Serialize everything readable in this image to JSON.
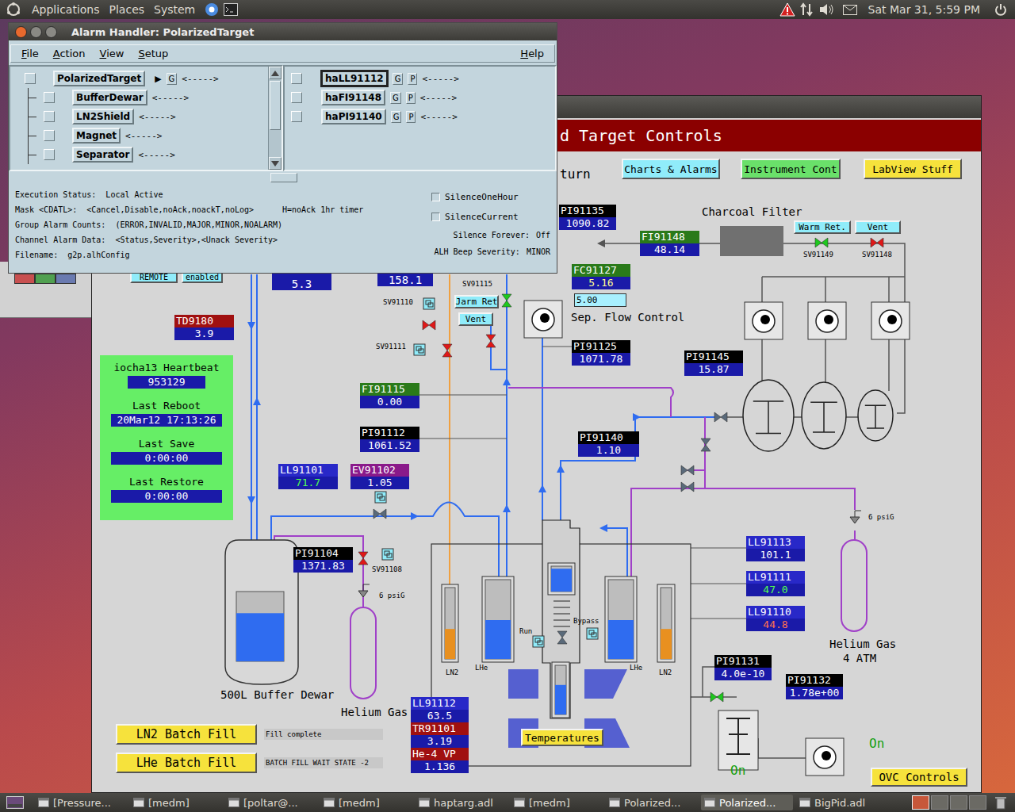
{
  "top_panel": {
    "menus": [
      "Applications",
      "Places",
      "System"
    ],
    "clock": "Sat Mar 31, 5:59 PM"
  },
  "alarm_handler": {
    "title": "Alarm Handler: PolarizedTarget",
    "menus": [
      "File",
      "Action",
      "View",
      "Setup"
    ],
    "help": "Help",
    "root": {
      "name": "PolarizedTarget",
      "arrow": "▶",
      "guidance": "G",
      "status": "<----->"
    },
    "children": [
      {
        "name": "BufferDewar",
        "status": "<----->"
      },
      {
        "name": "LN2Shield",
        "status": "<----->"
      },
      {
        "name": "Magnet",
        "status": "<----->"
      },
      {
        "name": "Separator",
        "status": "<----->"
      }
    ],
    "channels": [
      {
        "name": "haLL91112",
        "guidance": "G",
        "process": "P",
        "status": "<----->",
        "selected": true
      },
      {
        "name": "haFI91148",
        "guidance": "G",
        "process": "P",
        "status": "<----->",
        "selected": false
      },
      {
        "name": "haPI91140",
        "guidance": "G",
        "process": "P",
        "status": "<----->",
        "selected": false
      }
    ],
    "info": [
      [
        "Execution Status:",
        "Local Active"
      ],
      [
        "Mask <CDATL>:",
        "<Cancel,Disable,noAck,noackT,noLog>",
        "H=noAck 1hr timer"
      ],
      [
        "Group Alarm Counts:",
        "(ERROR,INVALID,MAJOR,MINOR,NOALARM)"
      ],
      [
        "Channel Alarm Data:",
        "<Status,Severity>,<Unack Severity>"
      ],
      [
        "Filename:",
        "g2p.alhConfig"
      ]
    ],
    "silence": [
      {
        "label": "SilenceOneHour",
        "checked": false
      },
      {
        "label": "SilenceCurrent",
        "checked": false
      }
    ],
    "settings": [
      [
        "Silence Forever:",
        "Off"
      ],
      [
        "ALH Beep Severity:",
        "MINOR"
      ]
    ]
  },
  "medm": {
    "labels": [
      {
        "text": "d Target Controls",
        "kind": "banner",
        "color": "#8b0000"
      },
      {
        "text": "turn",
        "kind": "plain",
        "color": "#000000"
      },
      {
        "text": "Charts & Alarms",
        "kind": "button",
        "color": "#90ecfa"
      },
      {
        "text": "Instrument Cont",
        "kind": "button",
        "color": "#6ae06a"
      },
      {
        "text": "LabView Stuff",
        "kind": "button",
        "color": "#f6e23c"
      },
      {
        "text": "Charcoal Filter",
        "kind": "plain",
        "color": "#000000"
      },
      {
        "text": "Warm Ret.",
        "kind": "button",
        "color": "#90ecfa"
      },
      {
        "text": "Vent",
        "kind": "button",
        "color": "#90ecfa"
      },
      {
        "text": "SV91149",
        "kind": "small",
        "color": "#000000"
      },
      {
        "text": "SV91148",
        "kind": "small",
        "color": "#000000"
      },
      {
        "text": "SV91115",
        "kind": "small",
        "color": "#000000"
      },
      {
        "text": "Jarm Ret",
        "kind": "button",
        "color": "#90ecfa"
      },
      {
        "text": "Vent",
        "kind": "button",
        "color": "#90ecfa"
      },
      {
        "text": "SV91110",
        "kind": "small",
        "color": "#000000"
      },
      {
        "text": "SV91111",
        "kind": "small",
        "color": "#000000"
      },
      {
        "text": "5.00",
        "kind": "input",
        "color": "#a8f0ff"
      },
      {
        "text": "Sep. Flow Control",
        "kind": "plain",
        "color": "#000000"
      },
      {
        "text": "SV91108",
        "kind": "small",
        "color": "#000000"
      },
      {
        "text": "6 psiG",
        "kind": "small",
        "color": "#000000"
      },
      {
        "text": "6 psiG",
        "kind": "small",
        "color": "#000000"
      },
      {
        "text": "500L Buffer Dewar",
        "kind": "plain",
        "color": "#000000"
      },
      {
        "text": "Helium Gas",
        "kind": "plain",
        "color": "#000000"
      },
      {
        "text": "Helium Gas",
        "kind": "plain",
        "color": "#000000"
      },
      {
        "text": "4 ATM",
        "kind": "plain",
        "color": "#000000"
      },
      {
        "text": "LN2",
        "kind": "small",
        "color": "#000000"
      },
      {
        "text": "LHe",
        "kind": "small",
        "color": "#000000"
      },
      {
        "text": "LHe",
        "kind": "small",
        "color": "#000000"
      },
      {
        "text": "LN2",
        "kind": "small",
        "color": "#000000"
      },
      {
        "text": "Run",
        "kind": "small",
        "color": "#000000"
      },
      {
        "text": "Bypass",
        "kind": "small",
        "color": "#000000"
      },
      {
        "text": "Temperatures",
        "kind": "button",
        "color": "#f6e23c"
      },
      {
        "text": "On",
        "kind": "plain",
        "color": "#10a010"
      },
      {
        "text": "On",
        "kind": "plain",
        "color": "#10a010"
      },
      {
        "text": "OVC Controls",
        "kind": "button",
        "color": "#f6e23c"
      },
      {
        "text": "LN2 Batch Fill",
        "kind": "button",
        "color": "#f6e23c"
      },
      {
        "text": "Fill complete",
        "kind": "display",
        "color": "#c8c8c8"
      },
      {
        "text": "LHe Batch Fill",
        "kind": "button",
        "color": "#f6e23c"
      },
      {
        "text": "BATCH FILL WAIT STATE -2",
        "kind": "display",
        "color": "#c8c8c8"
      },
      {
        "text": "REMOTE",
        "kind": "button",
        "color": "#90ecfa"
      },
      {
        "text": "enabled",
        "kind": "button",
        "color": "#90ecfa"
      },
      {
        "text": "5.3",
        "kind": "value",
        "color": "#1a1aa8"
      },
      {
        "text": "158.1",
        "kind": "value",
        "color": "#1a1aa8"
      }
    ],
    "readouts": [
      {
        "label": "PI91135",
        "value": "1090.82",
        "label_color": "#000000",
        "value_color": "#ffffff"
      },
      {
        "label": "FI91148",
        "value": "48.14",
        "label_color": "#2a7a1a",
        "value_color": "#ffffff"
      },
      {
        "label": "FC91127",
        "value": "5.16",
        "label_color": "#2a7a1a",
        "value_color": "#ffff90"
      },
      {
        "label": "PI91125",
        "value": "1071.78",
        "label_color": "#000000",
        "value_color": "#ffffff"
      },
      {
        "label": "PI91145",
        "value": "15.87",
        "label_color": "#000000",
        "value_color": "#ffffff"
      },
      {
        "label": "FI91115",
        "value": "0.00",
        "label_color": "#2a7a1a",
        "value_color": "#ffffff"
      },
      {
        "label": "PI91112",
        "value": "1061.52",
        "label_color": "#000000",
        "value_color": "#ffffff"
      },
      {
        "label": "PI91140",
        "value": "1.10",
        "label_color": "#000000",
        "value_color": "#ffffff"
      },
      {
        "label": "TD9180",
        "value": "3.9",
        "label_color": "#a01010",
        "value_color": "#ffffff"
      },
      {
        "label": "LL91101",
        "value": "71.7",
        "label_color": "#2828c8",
        "value_color": "#50ff50"
      },
      {
        "label": "EV91102",
        "value": "1.05",
        "label_color": "#8a1a8a",
        "value_color": "#ffffff"
      },
      {
        "label": "PI91104",
        "value": "1371.83",
        "label_color": "#000000",
        "value_color": "#ffffff"
      },
      {
        "label": "LL91113",
        "value": "101.1",
        "label_color": "#2828c8",
        "value_color": "#ffffff"
      },
      {
        "label": "LL91111",
        "value": "47.0",
        "label_color": "#2828c8",
        "value_color": "#50ff50"
      },
      {
        "label": "LL91110",
        "value": "44.8",
        "label_color": "#2828c8",
        "value_color": "#ff7050"
      },
      {
        "label": "PI91131",
        "value": "4.0e-10",
        "label_color": "#000000",
        "value_color": "#ffffff"
      },
      {
        "label": "PI91132",
        "value": "1.78e+00",
        "label_color": "#000000",
        "value_color": "#ffffff"
      },
      {
        "label": "LL91112",
        "value": "63.5",
        "label_color": "#2828c8",
        "value_color": "#ffffff"
      },
      {
        "label": "TR91101",
        "value": "3.19",
        "label_color": "#a01010",
        "value_color": "#ffffff"
      },
      {
        "label": "He-4 VP",
        "value": "1.136",
        "label_color": "#a01010",
        "value_color": "#ffffff"
      }
    ],
    "heartbeat": {
      "title": "iocha13 Heartbeat",
      "count": "953129",
      "items": [
        {
          "label": "Last Reboot",
          "value": "20Mar12 17:13:26"
        },
        {
          "label": "Last Save",
          "value": "0:00:00"
        },
        {
          "label": "Last Restore",
          "value": "0:00:00"
        }
      ]
    },
    "tanks": [
      {
        "level": 0.69,
        "color": "#2f6cf0"
      },
      {
        "level": 0.42,
        "color": "#e89020"
      },
      {
        "level": 0.49,
        "color": "#2f6cf0"
      },
      {
        "level": 0.9,
        "color": "#2f6cf0"
      },
      {
        "level": 0.6,
        "color": "#2f6cf0"
      },
      {
        "level": 0.49,
        "color": "#2f6cf0"
      },
      {
        "level": 0.42,
        "color": "#e89020"
      }
    ],
    "valves": [
      {
        "color": "#1ec81e"
      },
      {
        "color": "#e01818"
      },
      {
        "color": "#1ec81e"
      },
      {
        "color": "#e01818"
      },
      {
        "color": "#e01818"
      },
      {
        "color": "#e01818"
      },
      {
        "color": "#e01818"
      },
      {
        "color": "#5a6a7a"
      },
      {
        "color": "#5a6a7a"
      },
      {
        "color": "#5a6a7a"
      },
      {
        "color": "#5a6a7a"
      },
      {
        "color": "#5a6a7a"
      },
      {
        "color": "#1ec81e"
      },
      {
        "color": "#5a6a7a"
      }
    ]
  },
  "taskbar": {
    "items": [
      {
        "label": "[Pressure...",
        "selected": false
      },
      {
        "label": "[medm]",
        "selected": false
      },
      {
        "label": "[poltar@...",
        "selected": false
      },
      {
        "label": "[medm]",
        "selected": false
      },
      {
        "label": "haptarg.adl",
        "selected": false
      },
      {
        "label": "[medm]",
        "selected": false
      },
      {
        "label": "Polarized...",
        "selected": false
      },
      {
        "label": "Polarized...",
        "selected": true
      },
      {
        "label": "BigPid.adl",
        "selected": false
      }
    ],
    "workspaces": [
      {
        "selected": true
      },
      {
        "selected": false
      },
      {
        "selected": false
      },
      {
        "selected": false
      }
    ]
  }
}
